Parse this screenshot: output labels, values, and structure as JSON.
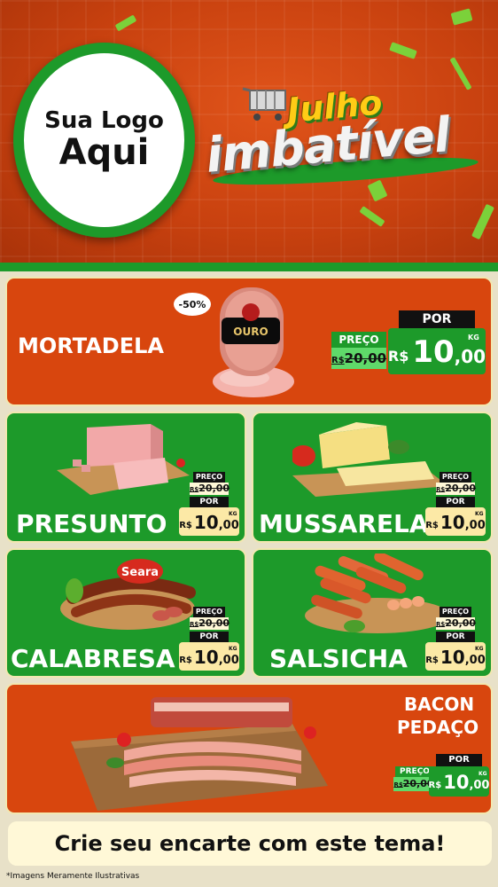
{
  "header": {
    "logo_line1": "Sua Logo",
    "logo_line2": "Aqui",
    "title_line1": "Julho",
    "title_line2": "imbatível"
  },
  "labels": {
    "preco": "PREÇO",
    "por": "POR",
    "currency": "R$",
    "unit": "KG"
  },
  "products": [
    {
      "name": "MORTADELA",
      "badge": "-50%",
      "old_price": "20,00",
      "price_int": "10",
      "price_dec": ",00"
    },
    {
      "name": "PRESUNTO",
      "old_price": "20,00",
      "price_int": "10",
      "price_dec": ",00"
    },
    {
      "name": "MUSSARELA",
      "old_price": "20,00",
      "price_int": "10",
      "price_dec": ",00"
    },
    {
      "name": "CALABRESA",
      "brand": "Seara",
      "old_price": "20,00",
      "price_int": "10",
      "price_dec": ",00"
    },
    {
      "name": "SALSICHA",
      "old_price": "20,00",
      "price_int": "10",
      "price_dec": ",00"
    },
    {
      "name_line1": "BACON",
      "name_line2": "PEDAÇO",
      "old_price": "20,00",
      "price_int": "10",
      "price_dec": ",00"
    }
  ],
  "mortadela_brand": "OURO",
  "banner": "Crie seu encarte com este tema!",
  "footnote": "*Imagens Meramente Ilustrativas",
  "colors": {
    "orange": "#d8460e",
    "green": "#1d9a2a",
    "light_green": "#5fd96a",
    "price_yellow": "#fce9a6",
    "cream": "#f2e7b0"
  }
}
